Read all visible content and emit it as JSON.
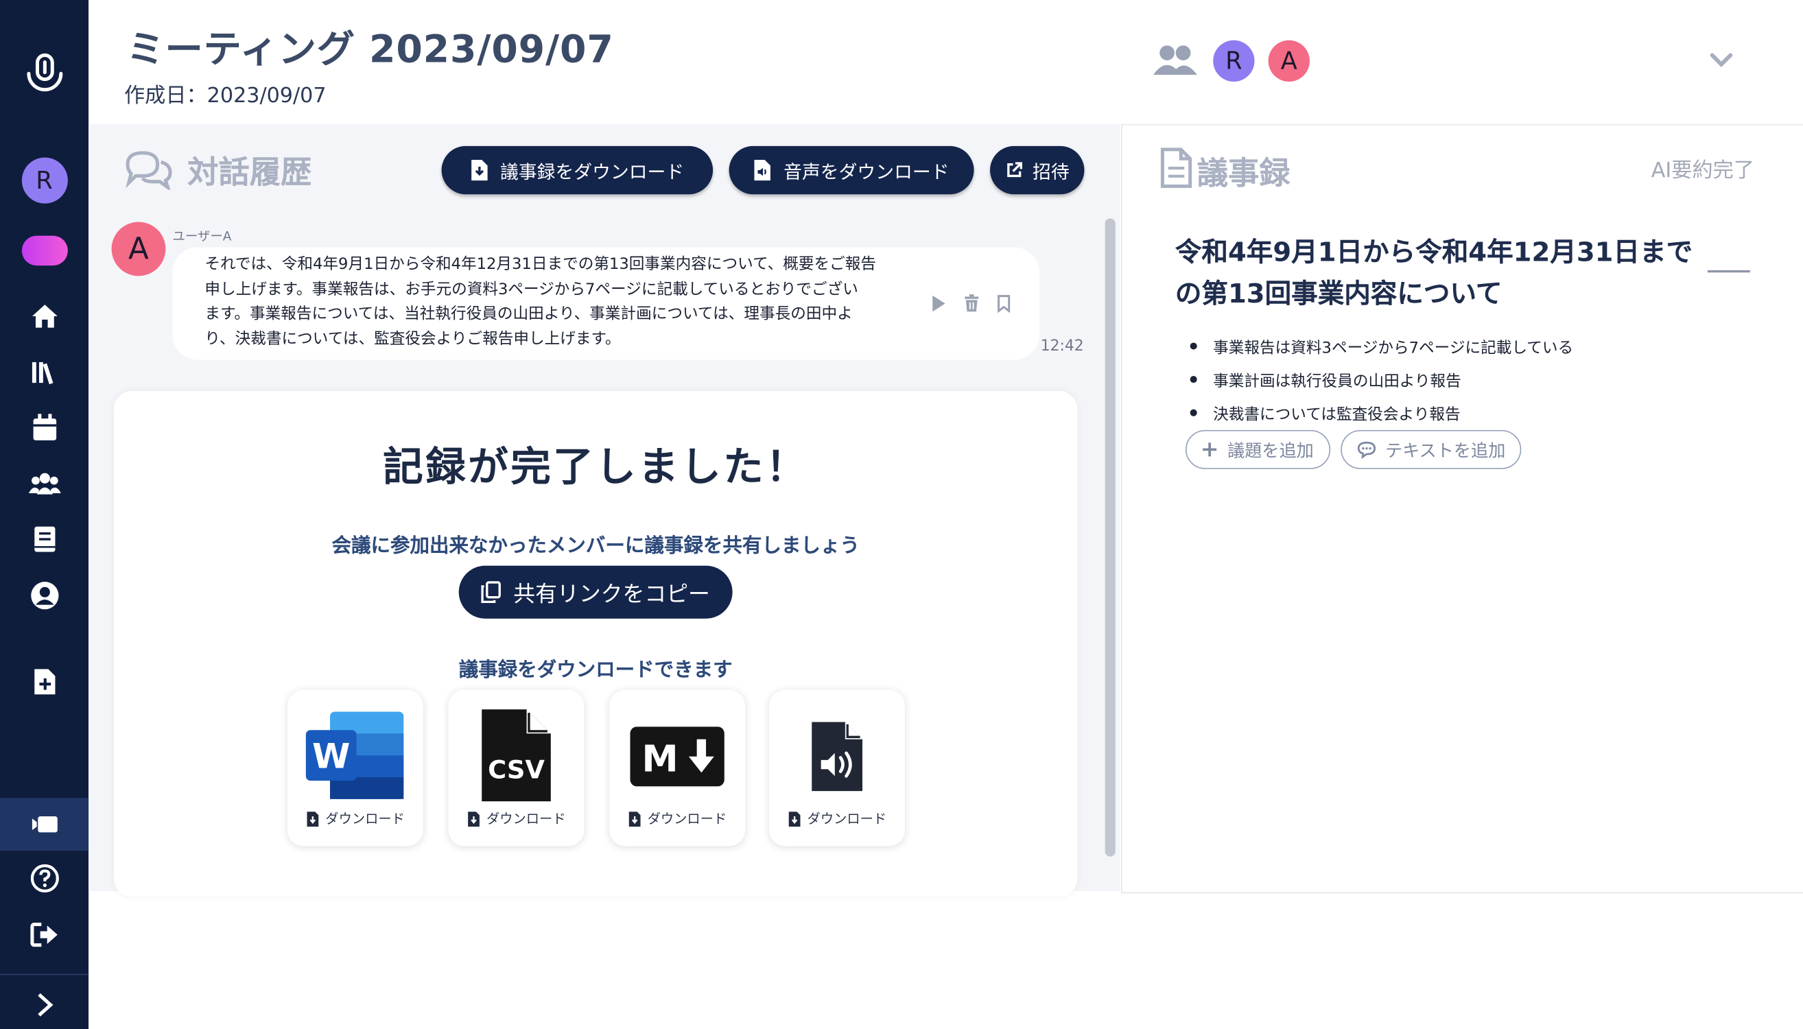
{
  "sidebar": {
    "avatar_initial": "R",
    "active_item": "meeting-record"
  },
  "header": {
    "title": "ミーティング 2023/09/07",
    "created": "作成日：2023/09/07",
    "participants": [
      {
        "initial": "R",
        "color": "#8f7cf2"
      },
      {
        "initial": "A",
        "color": "#f36b86"
      }
    ]
  },
  "conversation": {
    "heading": "対話履歴",
    "buttons": {
      "download_minutes": "議事録をダウンロード",
      "download_audio": "音声をダウンロード",
      "invite": "招待"
    },
    "message": {
      "avatar_initial": "A",
      "speaker": "ユーザーA",
      "lines": [
        "それでは、令和4年9月1日から令和4年12月31日までの第13回事業内容について、概要をご報告",
        "申し上げます。事業報告は、お手元の資料3ページから7ページに記載しているとおりでござい",
        "ます。事業報告については、当社執行役員の山田より、事業計画については、理事長の田中よ",
        "り、決裁書については、監査役会よりご報告申し上げます。"
      ],
      "time": "12:42"
    }
  },
  "completion": {
    "title": "記録が完了しました！",
    "share_prompt": "会議に参加出来なかったメンバーに議事録を共有しましょう",
    "copy_link": "共有リンクをコピー",
    "download_prompt": "議事録をダウンロードできます",
    "downloads": [
      {
        "format": "word-icon",
        "label": "ダウンロード",
        "glyph": "W"
      },
      {
        "format": "csv-icon",
        "label": "ダウンロード",
        "glyph": "CSV"
      },
      {
        "format": "markdown-icon",
        "label": "ダウンロード",
        "glyph": "M"
      },
      {
        "format": "audio-file-icon",
        "label": "ダウンロード",
        "glyph": ""
      }
    ]
  },
  "minutes": {
    "heading": "議事録",
    "status": "AI要約完了",
    "topic_lines": [
      "令和4年9月1日から令和4年12月31日まで",
      "の第13回事業内容について"
    ],
    "bullets": [
      "事業報告は資料3ページから7ページに記載している",
      "事業計画は執行役員の山田より報告",
      "決裁書については監査役会より報告"
    ],
    "add_topic": "議題を追加",
    "add_text": "テキストを追加"
  },
  "colors": {
    "sidebar": "#0f1d3d",
    "primary_button": "#14254b",
    "accent_toggle": "#e84df0",
    "avatar_a": "#f36b86",
    "avatar_r": "#8f7cf2"
  }
}
